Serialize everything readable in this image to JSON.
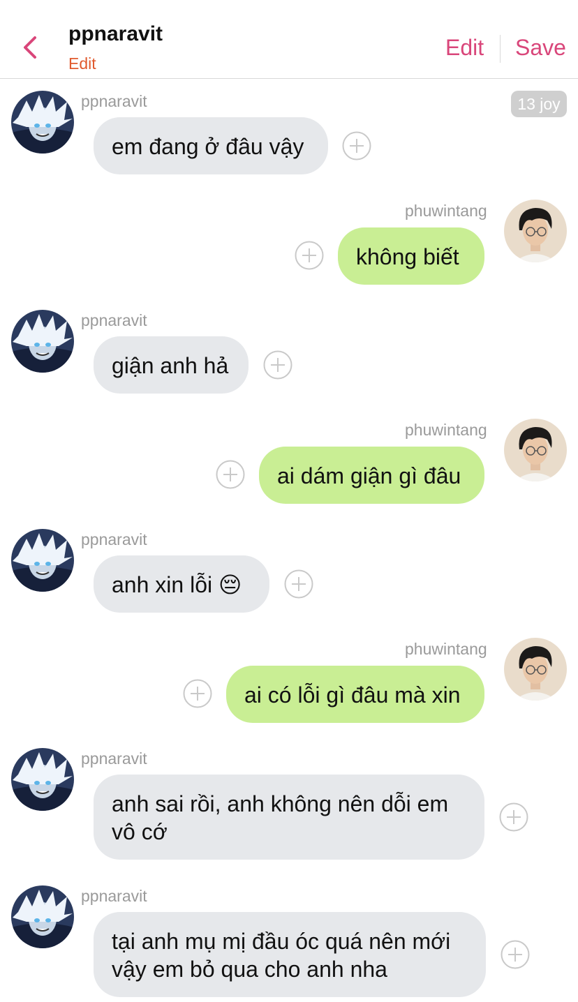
{
  "header": {
    "title": "ppnaravit",
    "subtitle": "Edit",
    "edit_label": "Edit",
    "save_label": "Save"
  },
  "timestamp": "13 joy",
  "messages": [
    {
      "sender": "ppnaravit",
      "text": "em đang ở đâu vậy"
    },
    {
      "sender": "phuwintang",
      "text": "không biết"
    },
    {
      "sender": "ppnaravit",
      "text": "giận anh hả"
    },
    {
      "sender": "phuwintang",
      "text": "ai dám giận gì đâu"
    },
    {
      "sender": "ppnaravit",
      "text": "anh xin lỗi 😔"
    },
    {
      "sender": "phuwintang",
      "text": "ai có lỗi gì đâu mà xin"
    },
    {
      "sender": "ppnaravit",
      "text": "anh sai rồi, anh không nên dỗi em vô cớ"
    },
    {
      "sender": "ppnaravit",
      "text": "tại anh mụ mị đầu óc quá nên mới vậy em bỏ qua cho anh nha"
    }
  ],
  "colors": {
    "accent": "#d9467a",
    "incoming_bubble": "#e6e8eb",
    "outgoing_bubble": "#c9ee94"
  }
}
